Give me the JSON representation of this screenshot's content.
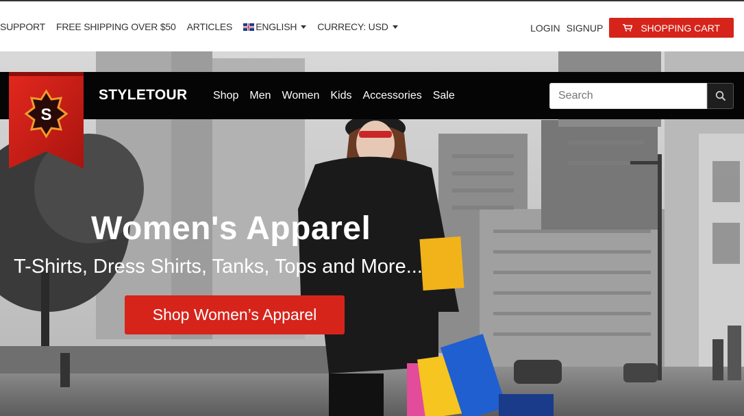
{
  "topbar": {
    "links": [
      "SUPPORT",
      "FREE SHIPPING OVER $50",
      "ARTICLES"
    ],
    "language": "ENGLISH",
    "currency": "CURRECY: USD",
    "login": "LOGIN",
    "signup": "SIGNUP",
    "cart": "SHOPPING CART"
  },
  "nav": {
    "logo_letter": "S",
    "brand": "STYLETOUR",
    "items": [
      "Shop",
      "Men",
      "Women",
      "Kids",
      "Accessories",
      "Sale"
    ],
    "search_placeholder": "Search"
  },
  "hero": {
    "title": "Women's Apparel",
    "subtitle": "T-Shirts, Dress Shirts, Tanks, Tops and More...",
    "cta": "Shop Women’s Apparel"
  },
  "icons": {
    "cart": "shopping-cart-icon",
    "search": "search-icon",
    "caret": "caret-down-icon",
    "flag": "uk-flag-icon"
  },
  "colors": {
    "accent": "#d6241b",
    "navbar": "#050505"
  }
}
